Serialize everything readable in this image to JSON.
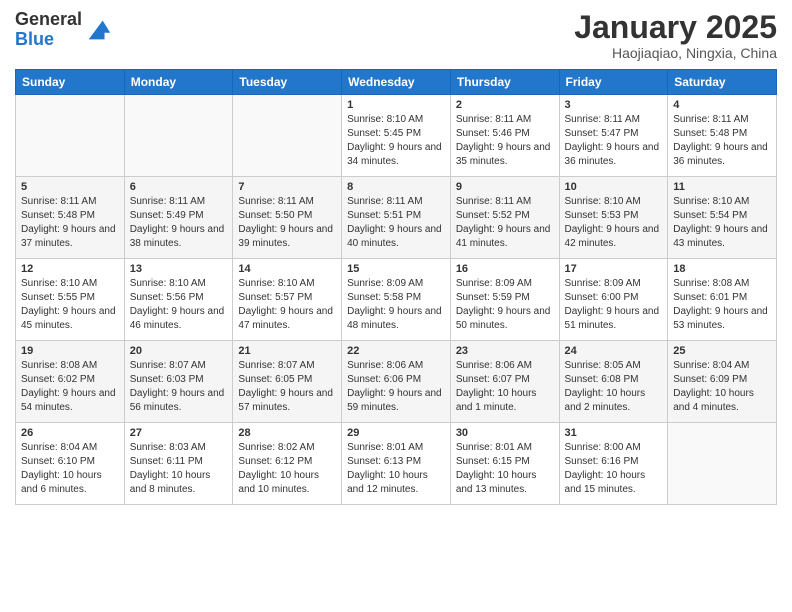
{
  "header": {
    "logo_line1": "General",
    "logo_line2": "Blue",
    "title": "January 2025",
    "subtitle": "Haojiaqiao, Ningxia, China"
  },
  "weekdays": [
    "Sunday",
    "Monday",
    "Tuesday",
    "Wednesday",
    "Thursday",
    "Friday",
    "Saturday"
  ],
  "weeks": [
    [
      {
        "day": "",
        "sunrise": "",
        "sunset": "",
        "daylight": ""
      },
      {
        "day": "",
        "sunrise": "",
        "sunset": "",
        "daylight": ""
      },
      {
        "day": "",
        "sunrise": "",
        "sunset": "",
        "daylight": ""
      },
      {
        "day": "1",
        "sunrise": "Sunrise: 8:10 AM",
        "sunset": "Sunset: 5:45 PM",
        "daylight": "Daylight: 9 hours and 34 minutes."
      },
      {
        "day": "2",
        "sunrise": "Sunrise: 8:11 AM",
        "sunset": "Sunset: 5:46 PM",
        "daylight": "Daylight: 9 hours and 35 minutes."
      },
      {
        "day": "3",
        "sunrise": "Sunrise: 8:11 AM",
        "sunset": "Sunset: 5:47 PM",
        "daylight": "Daylight: 9 hours and 36 minutes."
      },
      {
        "day": "4",
        "sunrise": "Sunrise: 8:11 AM",
        "sunset": "Sunset: 5:48 PM",
        "daylight": "Daylight: 9 hours and 36 minutes."
      }
    ],
    [
      {
        "day": "5",
        "sunrise": "Sunrise: 8:11 AM",
        "sunset": "Sunset: 5:48 PM",
        "daylight": "Daylight: 9 hours and 37 minutes."
      },
      {
        "day": "6",
        "sunrise": "Sunrise: 8:11 AM",
        "sunset": "Sunset: 5:49 PM",
        "daylight": "Daylight: 9 hours and 38 minutes."
      },
      {
        "day": "7",
        "sunrise": "Sunrise: 8:11 AM",
        "sunset": "Sunset: 5:50 PM",
        "daylight": "Daylight: 9 hours and 39 minutes."
      },
      {
        "day": "8",
        "sunrise": "Sunrise: 8:11 AM",
        "sunset": "Sunset: 5:51 PM",
        "daylight": "Daylight: 9 hours and 40 minutes."
      },
      {
        "day": "9",
        "sunrise": "Sunrise: 8:11 AM",
        "sunset": "Sunset: 5:52 PM",
        "daylight": "Daylight: 9 hours and 41 minutes."
      },
      {
        "day": "10",
        "sunrise": "Sunrise: 8:10 AM",
        "sunset": "Sunset: 5:53 PM",
        "daylight": "Daylight: 9 hours and 42 minutes."
      },
      {
        "day": "11",
        "sunrise": "Sunrise: 8:10 AM",
        "sunset": "Sunset: 5:54 PM",
        "daylight": "Daylight: 9 hours and 43 minutes."
      }
    ],
    [
      {
        "day": "12",
        "sunrise": "Sunrise: 8:10 AM",
        "sunset": "Sunset: 5:55 PM",
        "daylight": "Daylight: 9 hours and 45 minutes."
      },
      {
        "day": "13",
        "sunrise": "Sunrise: 8:10 AM",
        "sunset": "Sunset: 5:56 PM",
        "daylight": "Daylight: 9 hours and 46 minutes."
      },
      {
        "day": "14",
        "sunrise": "Sunrise: 8:10 AM",
        "sunset": "Sunset: 5:57 PM",
        "daylight": "Daylight: 9 hours and 47 minutes."
      },
      {
        "day": "15",
        "sunrise": "Sunrise: 8:09 AM",
        "sunset": "Sunset: 5:58 PM",
        "daylight": "Daylight: 9 hours and 48 minutes."
      },
      {
        "day": "16",
        "sunrise": "Sunrise: 8:09 AM",
        "sunset": "Sunset: 5:59 PM",
        "daylight": "Daylight: 9 hours and 50 minutes."
      },
      {
        "day": "17",
        "sunrise": "Sunrise: 8:09 AM",
        "sunset": "Sunset: 6:00 PM",
        "daylight": "Daylight: 9 hours and 51 minutes."
      },
      {
        "day": "18",
        "sunrise": "Sunrise: 8:08 AM",
        "sunset": "Sunset: 6:01 PM",
        "daylight": "Daylight: 9 hours and 53 minutes."
      }
    ],
    [
      {
        "day": "19",
        "sunrise": "Sunrise: 8:08 AM",
        "sunset": "Sunset: 6:02 PM",
        "daylight": "Daylight: 9 hours and 54 minutes."
      },
      {
        "day": "20",
        "sunrise": "Sunrise: 8:07 AM",
        "sunset": "Sunset: 6:03 PM",
        "daylight": "Daylight: 9 hours and 56 minutes."
      },
      {
        "day": "21",
        "sunrise": "Sunrise: 8:07 AM",
        "sunset": "Sunset: 6:05 PM",
        "daylight": "Daylight: 9 hours and 57 minutes."
      },
      {
        "day": "22",
        "sunrise": "Sunrise: 8:06 AM",
        "sunset": "Sunset: 6:06 PM",
        "daylight": "Daylight: 9 hours and 59 minutes."
      },
      {
        "day": "23",
        "sunrise": "Sunrise: 8:06 AM",
        "sunset": "Sunset: 6:07 PM",
        "daylight": "Daylight: 10 hours and 1 minute."
      },
      {
        "day": "24",
        "sunrise": "Sunrise: 8:05 AM",
        "sunset": "Sunset: 6:08 PM",
        "daylight": "Daylight: 10 hours and 2 minutes."
      },
      {
        "day": "25",
        "sunrise": "Sunrise: 8:04 AM",
        "sunset": "Sunset: 6:09 PM",
        "daylight": "Daylight: 10 hours and 4 minutes."
      }
    ],
    [
      {
        "day": "26",
        "sunrise": "Sunrise: 8:04 AM",
        "sunset": "Sunset: 6:10 PM",
        "daylight": "Daylight: 10 hours and 6 minutes."
      },
      {
        "day": "27",
        "sunrise": "Sunrise: 8:03 AM",
        "sunset": "Sunset: 6:11 PM",
        "daylight": "Daylight: 10 hours and 8 minutes."
      },
      {
        "day": "28",
        "sunrise": "Sunrise: 8:02 AM",
        "sunset": "Sunset: 6:12 PM",
        "daylight": "Daylight: 10 hours and 10 minutes."
      },
      {
        "day": "29",
        "sunrise": "Sunrise: 8:01 AM",
        "sunset": "Sunset: 6:13 PM",
        "daylight": "Daylight: 10 hours and 12 minutes."
      },
      {
        "day": "30",
        "sunrise": "Sunrise: 8:01 AM",
        "sunset": "Sunset: 6:15 PM",
        "daylight": "Daylight: 10 hours and 13 minutes."
      },
      {
        "day": "31",
        "sunrise": "Sunrise: 8:00 AM",
        "sunset": "Sunset: 6:16 PM",
        "daylight": "Daylight: 10 hours and 15 minutes."
      },
      {
        "day": "",
        "sunrise": "",
        "sunset": "",
        "daylight": ""
      }
    ]
  ]
}
